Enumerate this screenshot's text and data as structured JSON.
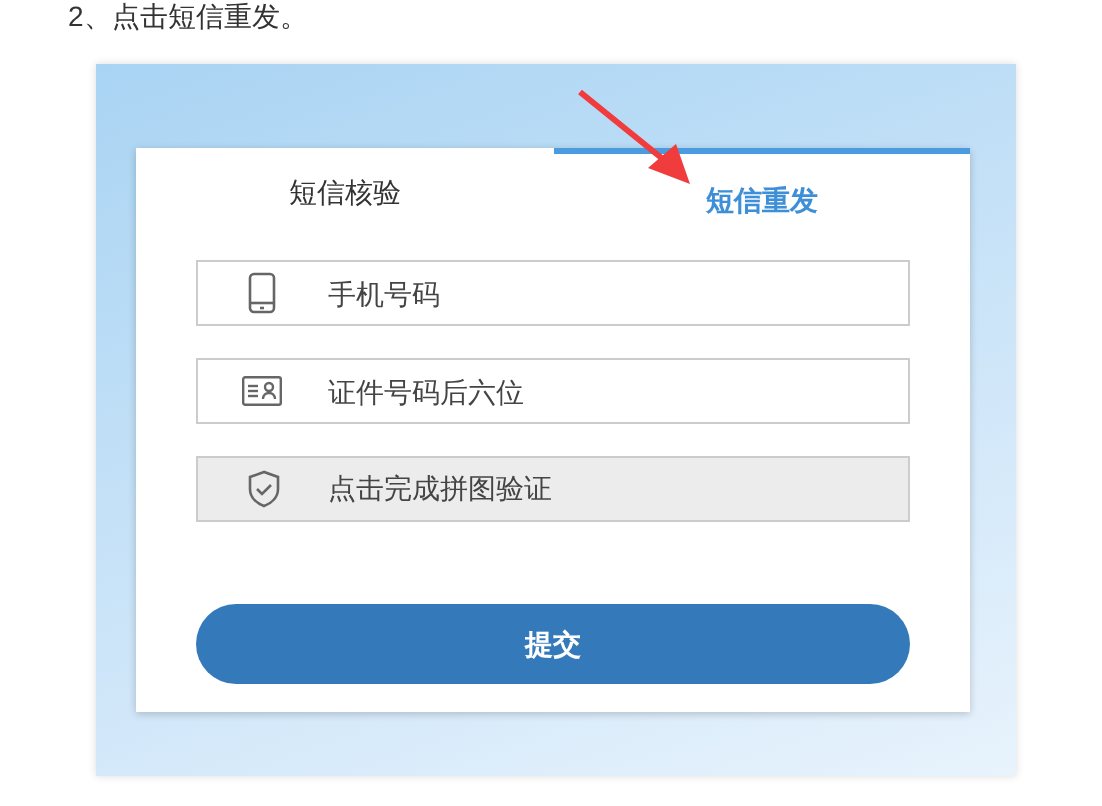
{
  "instruction": "2、点击短信重发。",
  "tabs": [
    {
      "label": "短信核验",
      "selected": false
    },
    {
      "label": "短信重发",
      "selected": true
    }
  ],
  "fields": [
    {
      "kind": "phone",
      "placeholder": "手机号码"
    },
    {
      "kind": "id",
      "placeholder": "证件号码后六位"
    },
    {
      "kind": "captcha",
      "label": "点击完成拼图验证"
    }
  ],
  "submit": "提交"
}
